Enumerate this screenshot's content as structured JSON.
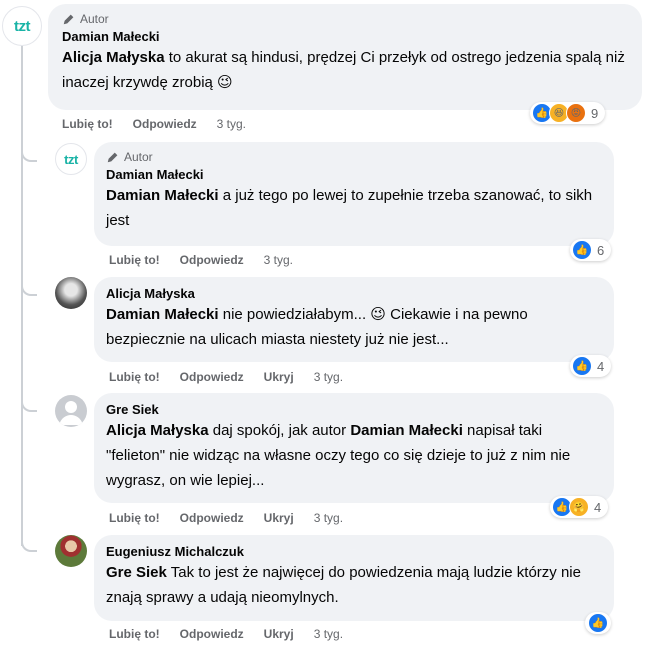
{
  "more_icon": "ellipsis-icon",
  "badge_label": "Autor",
  "comments": [
    {
      "author": "Damian Małecki",
      "mention": "Alicja Małyska",
      "text": " to akurat są hindusi, prędzej Ci przełyk od ostrego jedzenia spalą niż inaczej krzywdę zrobią 😉",
      "actions": [
        "Lubię to!",
        "Odpowiedz"
      ],
      "time": "3 tyg.",
      "reaction_count": "9"
    },
    {
      "author": "Damian Małecki",
      "mention": "Damian Małecki",
      "text": " a już tego po lewej to zupełnie trzeba szanować, to sikh jest",
      "actions": [
        "Lubię to!",
        "Odpowiedz"
      ],
      "time": "3 tyg.",
      "reaction_count": "6"
    },
    {
      "author": "Alicja Małyska",
      "mention": "Damian Małecki",
      "text": " nie powiedziałabym... 😉 Ciekawie i na pewno bezpiecznie na ulicach miasta niestety już nie jest...",
      "actions": [
        "Lubię to!",
        "Odpowiedz",
        "Ukryj"
      ],
      "time": "3 tyg.",
      "reaction_count": "4"
    },
    {
      "author": "Gre Siek",
      "mention": "Alicja Małyska",
      "text_1": " daj spokój, jak autor ",
      "mention_2": "Damian Małecki",
      "text_2": " napisał taki \"felieton\" nie widząc na własne oczy tego co się dzieje to już z nim nie wygrasz, on wie lepiej...",
      "actions": [
        "Lubię to!",
        "Odpowiedz",
        "Ukryj"
      ],
      "time": "3 tyg.",
      "reaction_count": "4"
    },
    {
      "author": "Eugeniusz Michalczuk",
      "mention": "Gre Siek",
      "text": " Tak to jest że najwięcej do powiedzenia mają ludzie którzy nie znają sprawy a udają nieomylnych.",
      "actions": [
        "Lubię to!",
        "Odpowiedz",
        "Ukryj"
      ],
      "time": "3 tyg."
    }
  ],
  "colors": {
    "bubble": "#f0f2f5",
    "muted": "#65676b",
    "like_blue": "#1877f2",
    "logo_teal": "#19b3a6"
  }
}
